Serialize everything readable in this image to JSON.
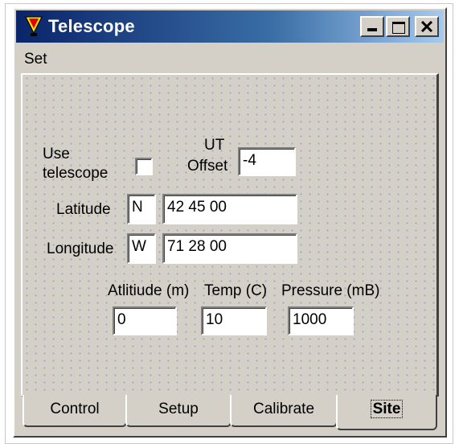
{
  "window": {
    "title": "Telescope"
  },
  "menu": {
    "items": [
      "Set"
    ]
  },
  "site": {
    "use_telescope_label_1": "Use",
    "use_telescope_label_2": "telescope",
    "use_telescope_checked": false,
    "ut_label_1": "UT",
    "ut_label_2": "Offset",
    "ut_offset": "-4",
    "latitude_label": "Latitude",
    "latitude_hemisphere": "N",
    "latitude_value": "42 45 00",
    "longitude_label": "Longitude",
    "longitude_hemisphere": "W",
    "longitude_value": "71 28 00",
    "altitude_label": "Atlitiude (m)",
    "altitude_value": "0",
    "temp_label": "Temp (C)",
    "temp_value": "10",
    "pressure_label": "Pressure (mB)",
    "pressure_value": "1000"
  },
  "tabs": {
    "items": [
      "Control",
      "Setup",
      "Calibrate",
      "Site"
    ],
    "active": "Site"
  },
  "colors": {
    "title_start": "#0a246a",
    "title_end": "#a6caf0",
    "face": "#d4d0c8",
    "app_icon_red": "#e00000",
    "app_icon_yellow": "#ffe000"
  },
  "icons": {
    "app": "telescope-app-icon",
    "minimize": "minimize-icon",
    "maximize": "maximize-icon",
    "close": "close-icon"
  }
}
